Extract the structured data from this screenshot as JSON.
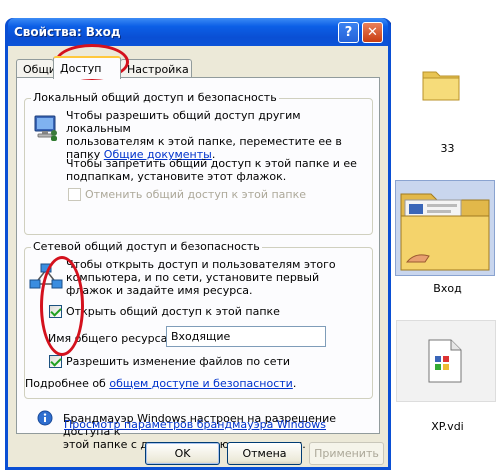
{
  "window": {
    "title": "Свойства: Вход",
    "help_glyph": "?",
    "close_glyph": "✕"
  },
  "tabs": [
    {
      "label": "Общие",
      "active": false
    },
    {
      "label": "Доступ",
      "active": true
    },
    {
      "label": "Настройка",
      "active": false
    }
  ],
  "local_sharing": {
    "legend": "Локальный общий доступ и безопасность",
    "line1": "Чтобы разрешить общий доступ другим локальным",
    "line2": "пользователям к этой папке, переместите ее в",
    "line3_prefix": "папку ",
    "shared_docs_link": "Общие документы",
    "line3_suffix": ".",
    "private_line1": "Чтобы запретить общий доступ к этой папке и ее",
    "private_line2": "подпапкам, установите этот флажок.",
    "private_checkbox_label": "Отменить общий доступ к этой папке",
    "private_checked": false
  },
  "network_sharing": {
    "legend": "Сетевой общий доступ и безопасность",
    "line1": "Чтобы открыть доступ и пользователям этого",
    "line2": "компьютера, и по сети, установите первый",
    "line3": "флажок и задайте имя ресурса.",
    "share_checkbox_label": "Открыть общий доступ к этой папке",
    "share_checked": true,
    "share_name_label": "Имя общего ресурса:",
    "share_name_value": "Входящие",
    "allow_change_label": "Разрешить изменение файлов по сети",
    "allow_change_checked": true,
    "more_prefix": "Подробнее об ",
    "more_link": "общем доступе и безопасности",
    "more_suffix": "."
  },
  "firewall": {
    "line1": "Брандмауэр Windows настроен на разрешение доступа к",
    "line2": "этой папке с других компьютеров в сети.",
    "link": "Просмотр параметров брандмауэра Windows"
  },
  "buttons": {
    "ok": "OK",
    "cancel": "Отмена",
    "apply": "Применить"
  },
  "files": [
    {
      "name": "33",
      "icon": "folder-icon"
    },
    {
      "name": "Вход",
      "icon": "shared-folder-icon"
    },
    {
      "name": "XP.vdi",
      "icon": "file-icon"
    }
  ],
  "colors": {
    "title_bar": "#0a4fd4",
    "dialog_face": "#ece9d8",
    "link": "#0033cc",
    "annotation": "#d4111d"
  }
}
